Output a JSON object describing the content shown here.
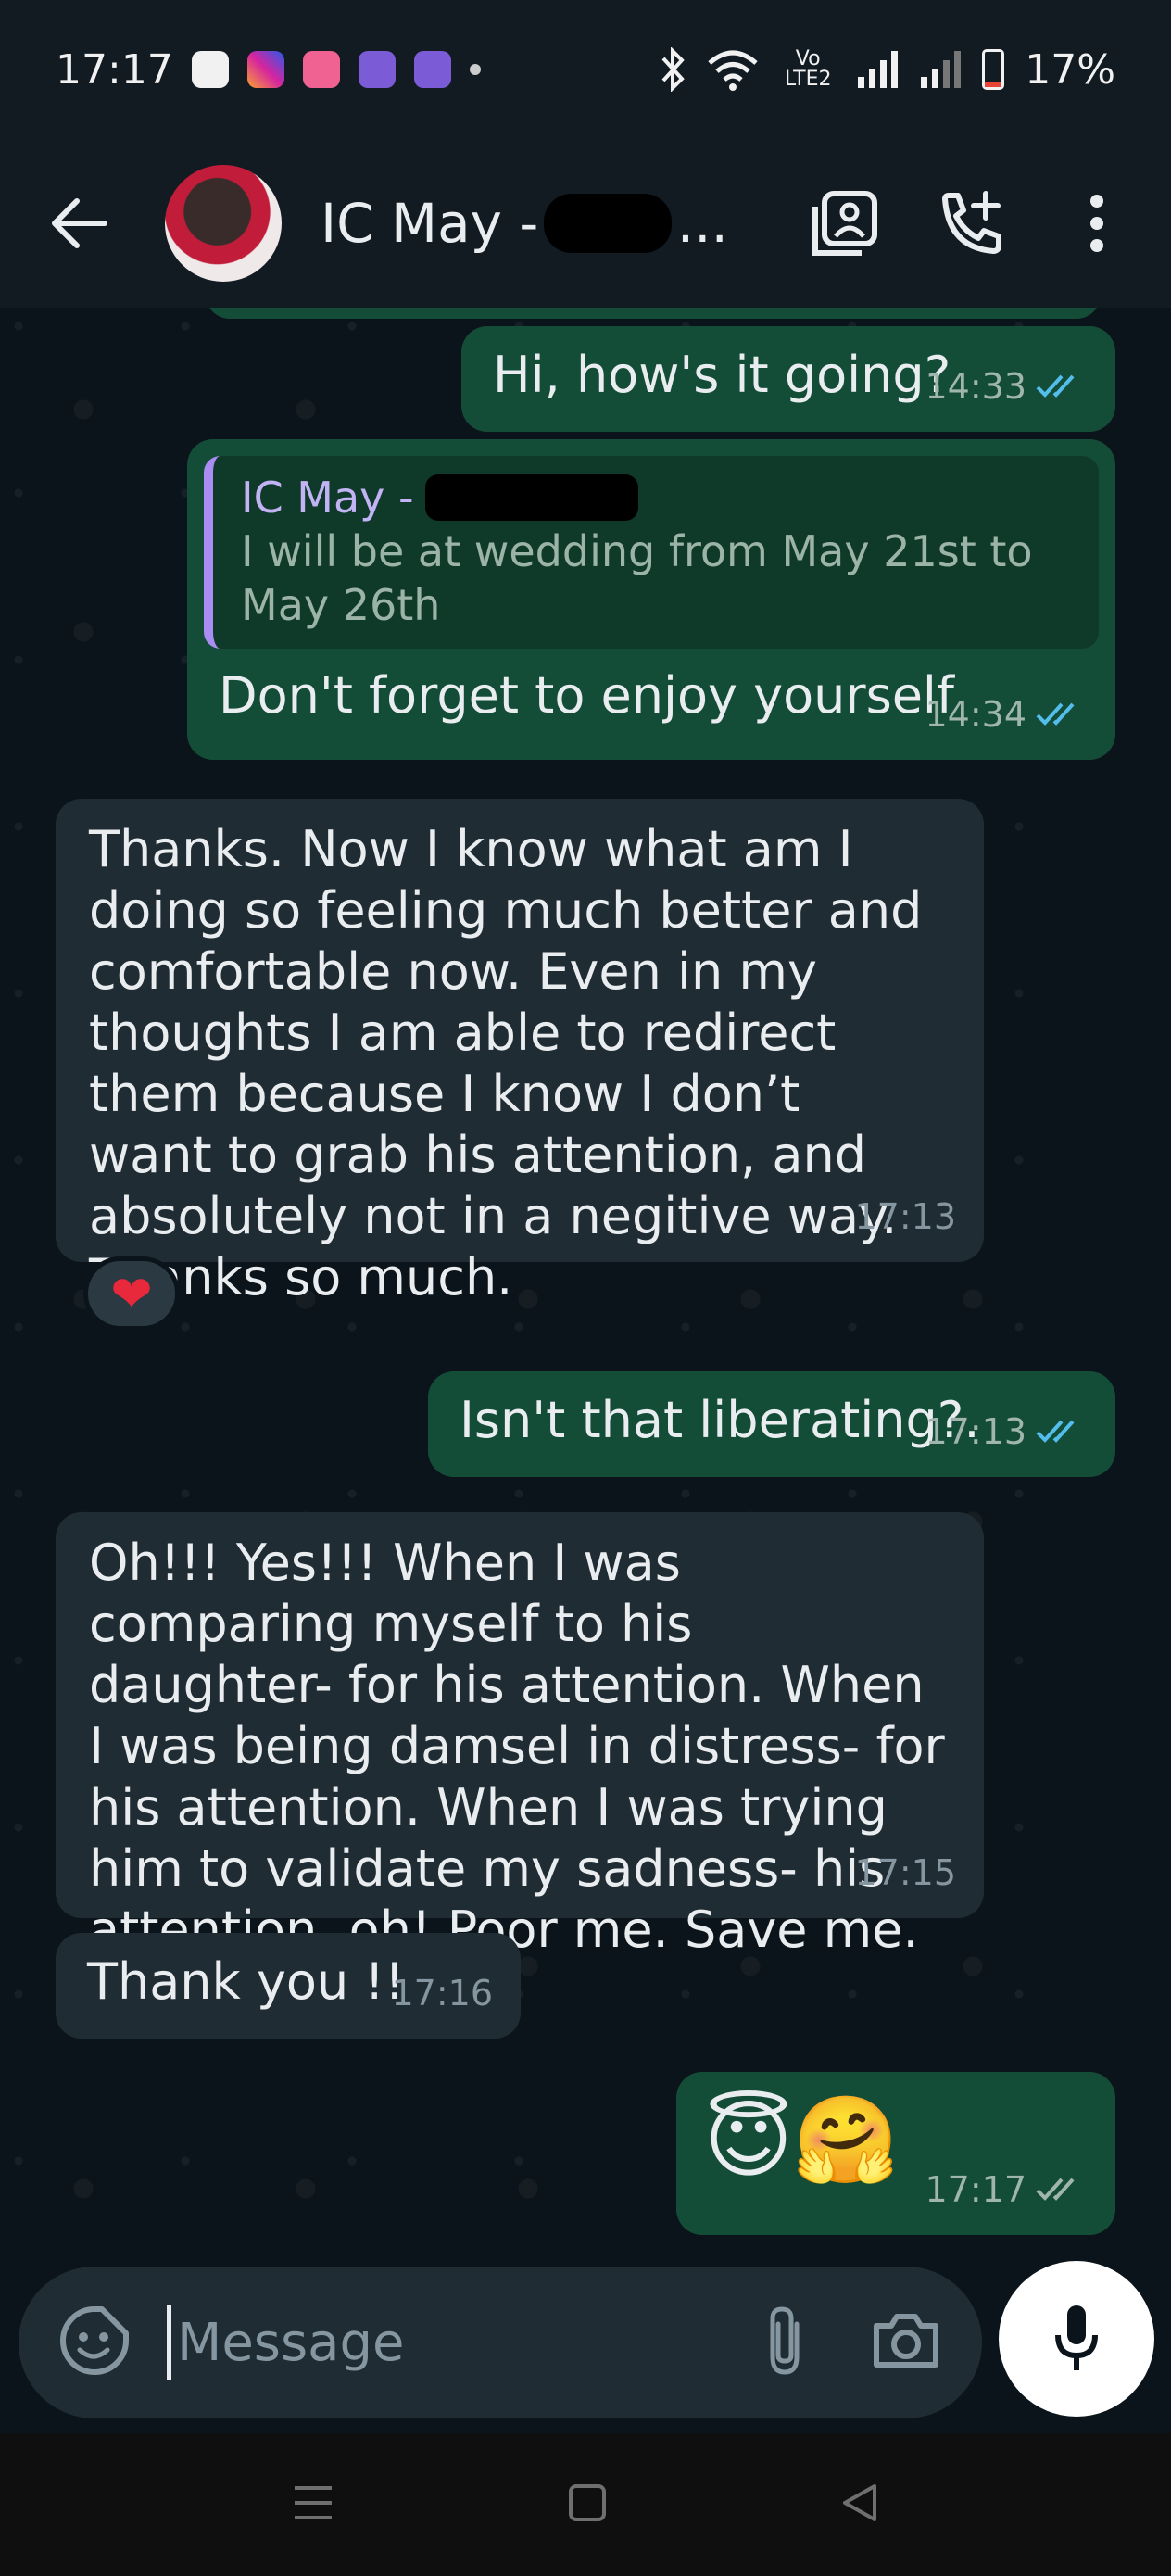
{
  "status_bar": {
    "time": "17:17",
    "battery": "17%",
    "network": "Vo LTE2",
    "battery_level": 0.17,
    "notification_icons": [
      "app-a-icon",
      "instagram-icon",
      "notes-icon",
      "app-chat-icon",
      "app-chat-icon"
    ]
  },
  "header": {
    "contact_name": "IC May -",
    "contact_name_suffix": "...",
    "icons": [
      "back-arrow-icon",
      "video-call-icon",
      "add-call-icon",
      "more-options-icon"
    ]
  },
  "messages": [
    {
      "direction": "out",
      "text": "Hi, how's it going?",
      "time": "14:33",
      "status": "read"
    },
    {
      "direction": "out",
      "quote_name": "IC May -",
      "quote_text": "I will be at wedding from May 21st to May 26th",
      "text": "Don't forget to enjoy yourself",
      "time": "14:34",
      "status": "read"
    },
    {
      "direction": "in",
      "text": "Thanks. Now I know what am I doing so feeling much better and comfortable now. Even in my thoughts I am able to redirect them because I know I don’t want to grab his attention, and absolutely not in a negitive way. Thanks so much.",
      "time": "17:13",
      "reaction": "❤"
    },
    {
      "direction": "out",
      "text": "Isn't that liberating?.",
      "time": "17:13",
      "status": "read"
    },
    {
      "direction": "in",
      "text": "Oh!!! Yes!!! When I was comparing myself to his daughter- for his attention. When I was being damsel in distress- for his attention. When I was trying him to validate my sadness- his attention, oh! Poor me. Save me.",
      "time": "17:15"
    },
    {
      "direction": "in",
      "text": "Thank you !!",
      "time": "17:16"
    },
    {
      "direction": "out",
      "text": "😇🤗",
      "time": "17:17",
      "status": "delivered"
    }
  ],
  "composer": {
    "placeholder": "Message",
    "icons": [
      "sticker-icon",
      "attach-icon",
      "camera-icon",
      "mic-icon"
    ]
  },
  "colors": {
    "outgoing_bubble": "#144d37",
    "incoming_bubble": "#202c33",
    "read_tick": "#53bdeb",
    "background": "#0b141a"
  }
}
